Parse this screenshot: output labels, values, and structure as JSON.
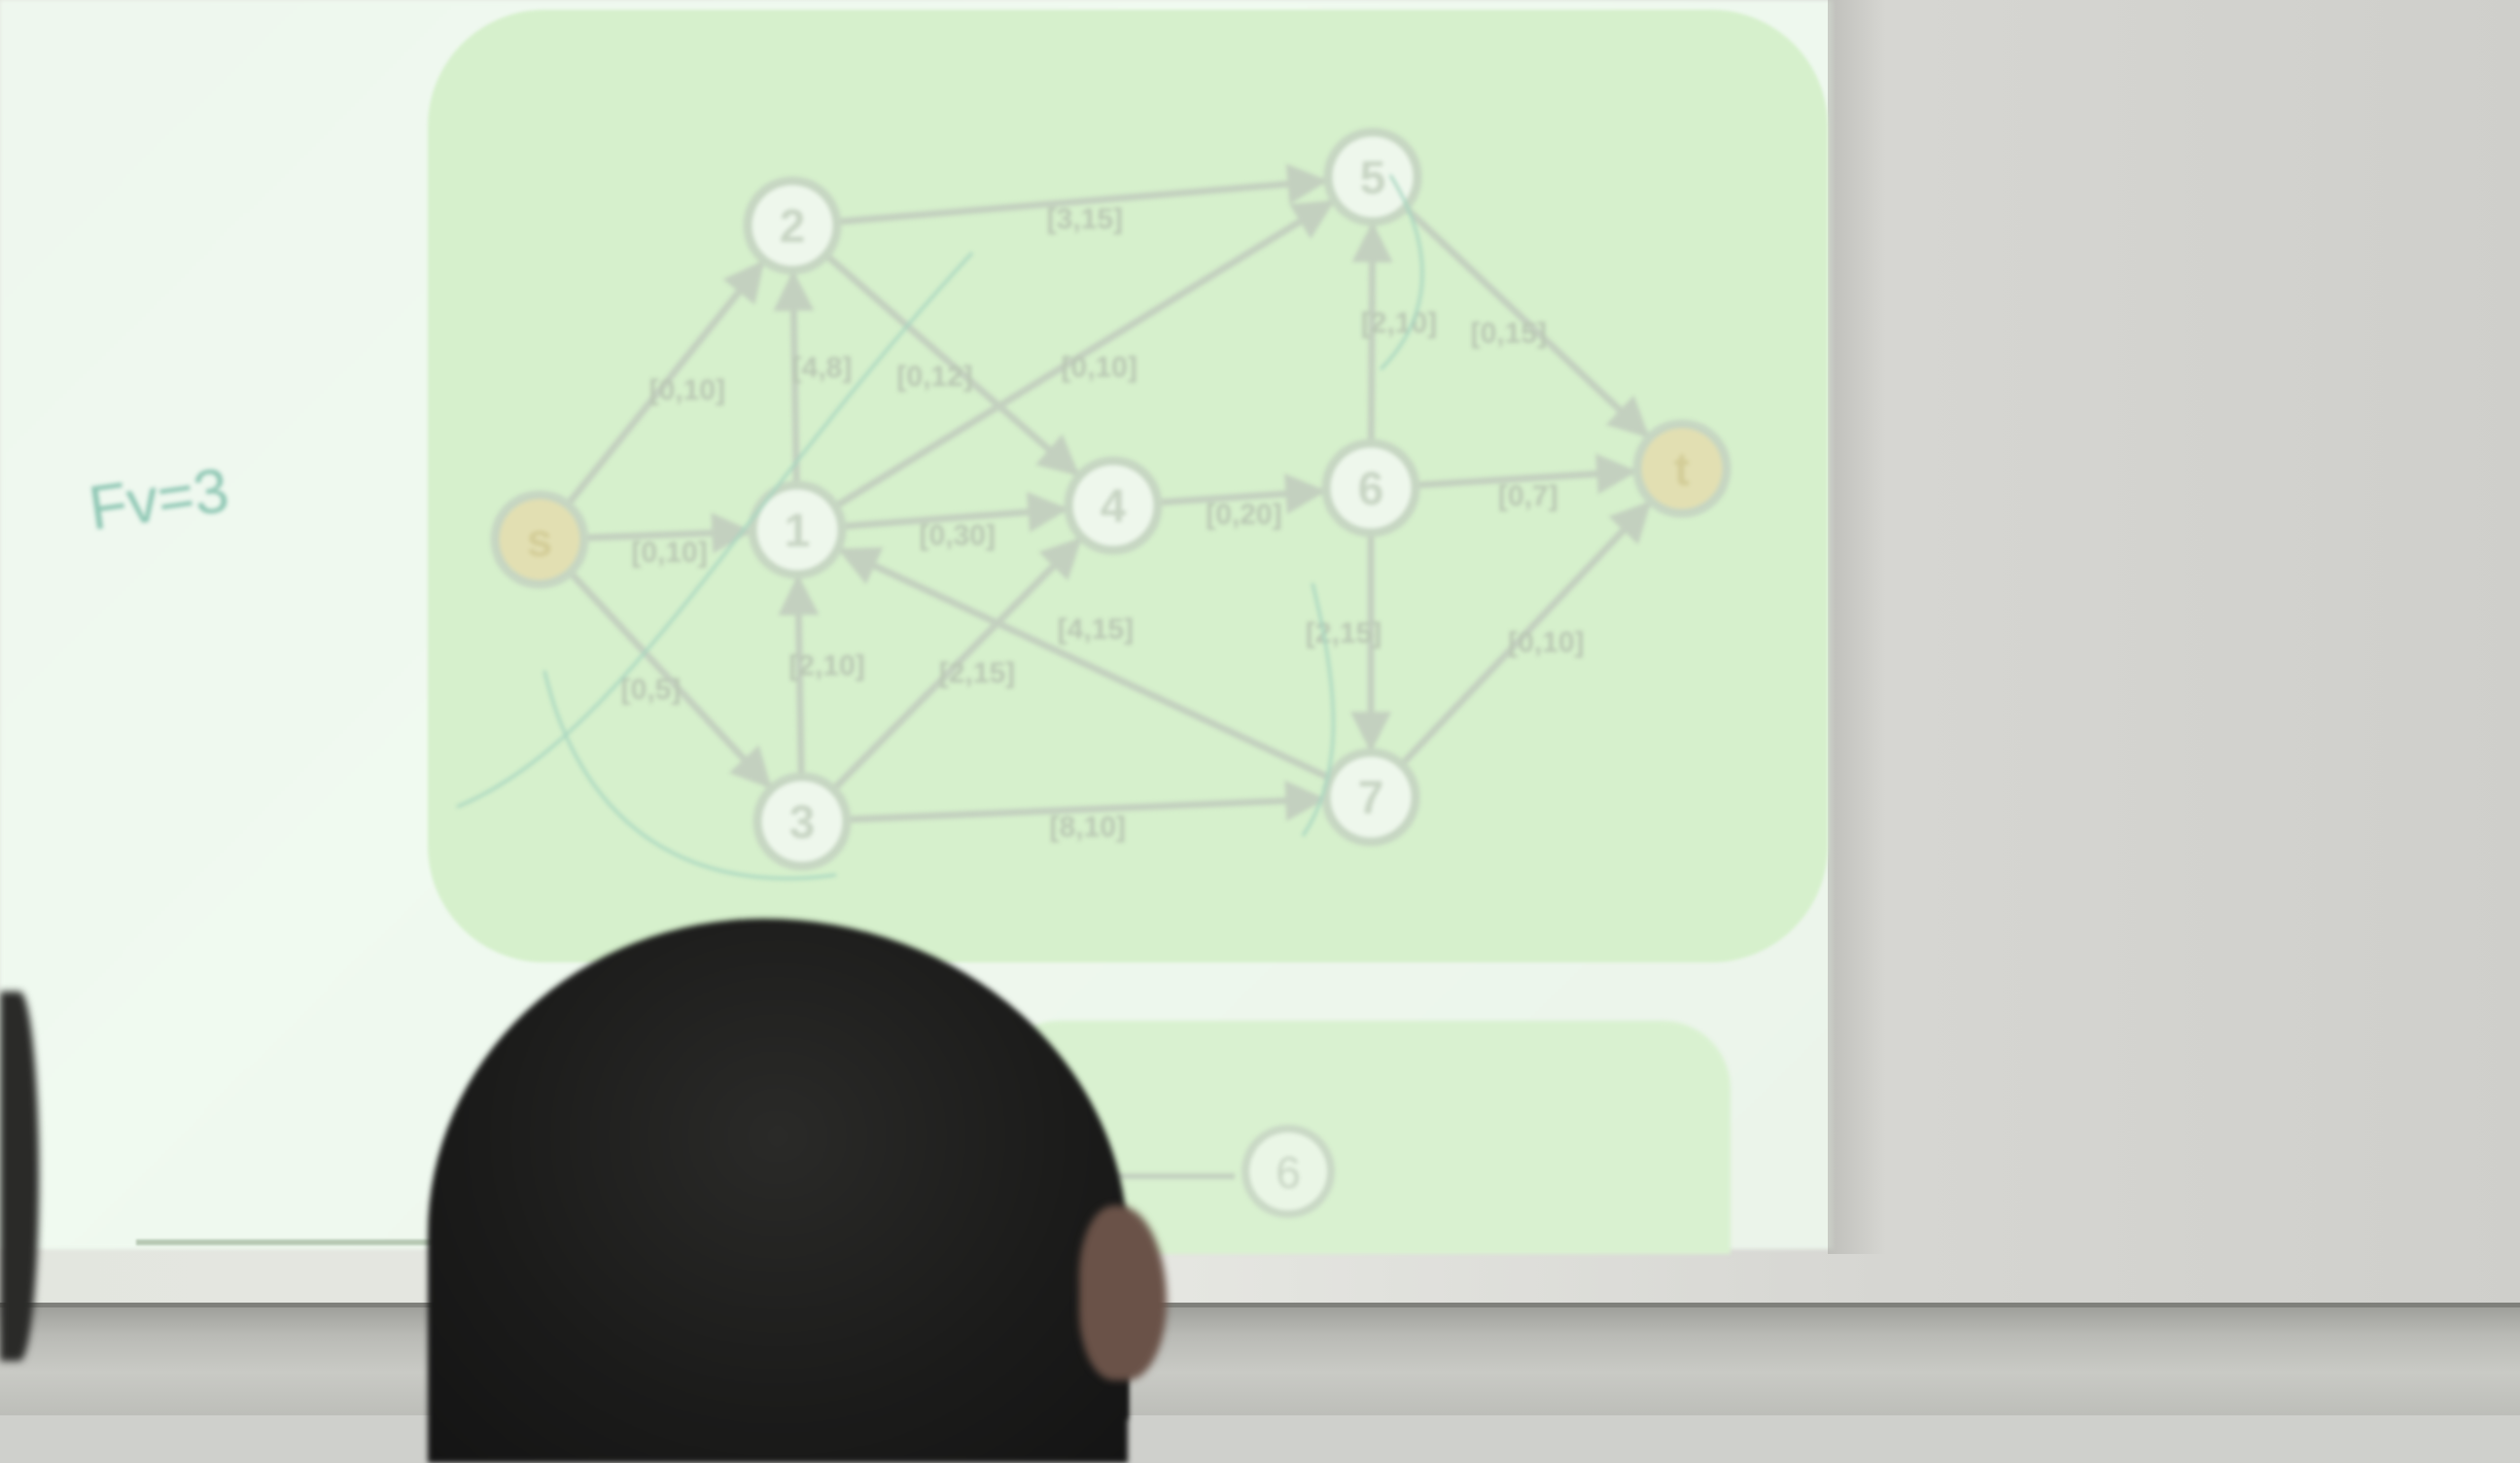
{
  "scene": {
    "colors": {
      "panel": "#d6f0cc",
      "node_fill": "#eef7ec",
      "node_stroke": "#c6d6c2",
      "node_text": "#c8d5c4",
      "edge": "#c3d0bf",
      "label_text": "#b9c7b3",
      "handwriting": "#8fc7b4",
      "source_sink_fill": "#e2dfb2"
    },
    "handwritten_note": "Fv=3",
    "bottom_node_label": "6"
  },
  "graph": {
    "nodes": [
      {
        "id": "s",
        "label": "s",
        "kind": "source"
      },
      {
        "id": "1",
        "label": "1",
        "kind": "normal"
      },
      {
        "id": "2",
        "label": "2",
        "kind": "normal"
      },
      {
        "id": "3",
        "label": "3",
        "kind": "normal"
      },
      {
        "id": "4",
        "label": "4",
        "kind": "normal"
      },
      {
        "id": "5",
        "label": "5",
        "kind": "normal"
      },
      {
        "id": "6",
        "label": "6",
        "kind": "normal"
      },
      {
        "id": "7",
        "label": "7",
        "kind": "normal"
      },
      {
        "id": "t",
        "label": "t",
        "kind": "sink"
      }
    ],
    "edges": [
      {
        "from": "s",
        "to": "2",
        "label": "[0,10]"
      },
      {
        "from": "s",
        "to": "1",
        "label": "[0,10]"
      },
      {
        "from": "s",
        "to": "3",
        "label": "[0,5]"
      },
      {
        "from": "1",
        "to": "2",
        "label": "[4,8]"
      },
      {
        "from": "3",
        "to": "1",
        "label": "[2,10]"
      },
      {
        "from": "2",
        "to": "5",
        "label": "[3,15]"
      },
      {
        "from": "2",
        "to": "4",
        "label": "[0,12]"
      },
      {
        "from": "1",
        "to": "4",
        "label": "[0,30]"
      },
      {
        "from": "1",
        "to": "5",
        "label": "[0,10]"
      },
      {
        "from": "3",
        "to": "4",
        "label": "[2,15]"
      },
      {
        "from": "4",
        "to": "6",
        "label": "[0,20]"
      },
      {
        "from": "7",
        "to": "1",
        "label": "[4,15]"
      },
      {
        "from": "3",
        "to": "7",
        "label": "[8,10]"
      },
      {
        "from": "6",
        "to": "5",
        "label": "[2,10]"
      },
      {
        "from": "6",
        "to": "7",
        "label": "[2,15]"
      },
      {
        "from": "5",
        "to": "t",
        "label": "[0,15]"
      },
      {
        "from": "6",
        "to": "t",
        "label": "[0,7]"
      },
      {
        "from": "7",
        "to": "t",
        "label": "[0,10]"
      }
    ]
  }
}
